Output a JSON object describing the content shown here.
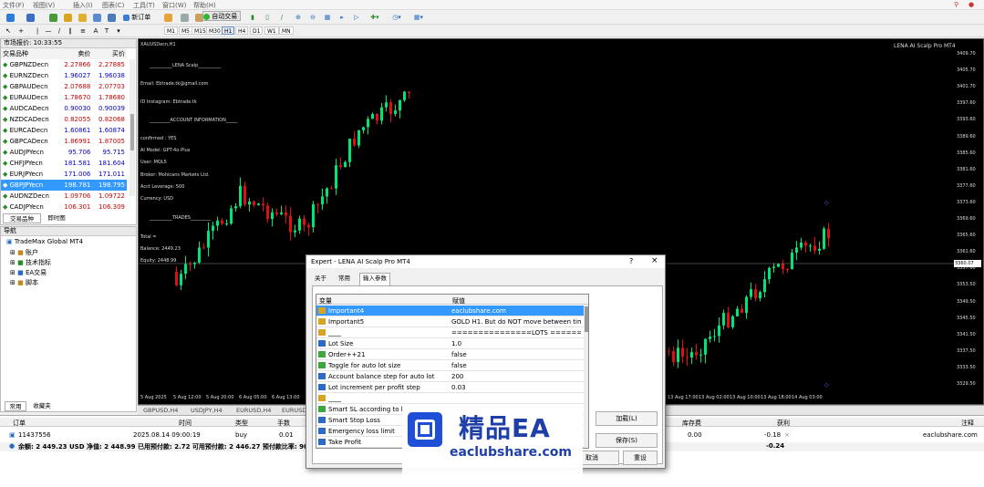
{
  "menu": [
    "文件(F)",
    "视图(V)",
    "插入(I)",
    "图表(C)",
    "工具(T)",
    "窗口(W)",
    "帮助(H)"
  ],
  "toolbar": {
    "new_order": "新订单",
    "auto_trade": "自动交易"
  },
  "timeframes": [
    "M1",
    "M5",
    "M15",
    "M30",
    "H1",
    "H4",
    "D1",
    "W1",
    "MN"
  ],
  "market_watch": {
    "title": "市场报价: 10:33:55",
    "col_symbol": "交易品种",
    "col_bid": "卖价",
    "col_ask": "买价",
    "rows": [
      {
        "symbol": "GBPNZDecn",
        "bid": "2.27866",
        "ask": "2.27885"
      },
      {
        "symbol": "EURNZDecn",
        "bid": "1.96027",
        "ask": "1.96038"
      },
      {
        "symbol": "GBPAUDecn",
        "bid": "2.07688",
        "ask": "2.07703"
      },
      {
        "symbol": "EURAUDecn",
        "bid": "1.78670",
        "ask": "1.78680"
      },
      {
        "symbol": "AUDCADecn",
        "bid": "0.90030",
        "ask": "0.90039"
      },
      {
        "symbol": "NZDCADecn",
        "bid": "0.82055",
        "ask": "0.82068"
      },
      {
        "symbol": "EURCADecn",
        "bid": "1.60861",
        "ask": "1.60874"
      },
      {
        "symbol": "GBPCADecn",
        "bid": "1.86991",
        "ask": "1.87005"
      },
      {
        "symbol": "AUDJPYecn",
        "bid": "95.706",
        "ask": "95.715"
      },
      {
        "symbol": "CHFJPYecn",
        "bid": "181.581",
        "ask": "181.604"
      },
      {
        "symbol": "EURJPYecn",
        "bid": "171.006",
        "ask": "171.011"
      },
      {
        "symbol": "GBPJPYecn",
        "bid": "198.781",
        "ask": "198.795"
      },
      {
        "symbol": "AUDNZDecn",
        "bid": "1.09706",
        "ask": "1.09722"
      },
      {
        "symbol": "CADJPYecn",
        "bid": "106.301",
        "ask": "106.309"
      }
    ],
    "tabs": [
      "交易品种",
      "即时图"
    ]
  },
  "navigator": {
    "title": "导航",
    "root": "TradeMax Global MT4",
    "items": [
      "账户",
      "技术指标",
      "EA交易",
      "脚本"
    ],
    "tabs": [
      "常用",
      "收藏夹"
    ]
  },
  "chart": {
    "symbol_label": "XAUUSDecn,H1",
    "ea_label": "LENA AI Scalp Pro MT4",
    "info_lines": [
      "__________LENA Scalp__________",
      "Email:       Ebtrade.tk@gmail.com",
      "ID Instagram:      Ebtrade.tk",
      "_________ACCOUNT INFORMATION_____",
      "confirmed :      YES",
      "AI Model:       GPT-4o-Plus",
      "User:               MQL5",
      "Broker:              Mohicans Markets Ltd.",
      "Acct Leverage:     500",
      "Currency:           USD",
      "__________TRADES_________",
      "Total =",
      "Balance:                2449.23",
      "Equity:                  2448.99"
    ],
    "price_axis": [
      "3409.70",
      "3405.70",
      "3401.70",
      "3397.60",
      "3393.60",
      "3389.60",
      "3385.60",
      "3381.60",
      "3377.60",
      "3373.60",
      "3369.60",
      "3365.60",
      "3361.60",
      "3357.60",
      "3353.50",
      "3349.50",
      "3345.50",
      "3341.50",
      "3337.50",
      "3333.50",
      "3329.50"
    ],
    "current_price": "3360.07",
    "time_axis_left": [
      "5 Aug 2025",
      "5 Aug 12:00",
      "5 Aug 20:00",
      "6 Aug 05:00",
      "6 Aug 13:00"
    ],
    "time_axis_right": [
      "13 Aug 17:00",
      "13 Aug 02:00",
      "13 Aug 10:00",
      "13 Aug 18:00",
      "14 Aug 03:00"
    ]
  },
  "chart_tabs": [
    "GBPUSD,H4",
    "USDJPY,H4",
    "EURUSD,H4",
    "EURUSD"
  ],
  "dialog": {
    "title": "Expert - LENA AI Scalp Pro MT4",
    "help": "?",
    "close": "×",
    "tabs": [
      "关于",
      "常用",
      "输入参数"
    ],
    "col_var": "变量",
    "col_val": "赋值",
    "rows": [
      {
        "name": "Important4",
        "value": "eaclubshare.com"
      },
      {
        "name": "Important5",
        "value": "GOLD H1. But do NOT move between tim..."
      },
      {
        "name": "____",
        "value": "===============LOTS ========="
      },
      {
        "name": "Lot Size",
        "value": "1.0"
      },
      {
        "name": "Order++21",
        "value": "false"
      },
      {
        "name": "Toggle for auto lot size",
        "value": "false"
      },
      {
        "name": "Account balance step for auto lot",
        "value": "200"
      },
      {
        "name": "Lot increment per profit step",
        "value": "0.03"
      },
      {
        "name": "____",
        "value": ""
      },
      {
        "name": "Smart SL according to b",
        "value": ""
      },
      {
        "name": "Smart Stop Loss",
        "value": ""
      },
      {
        "name": "Emergency loss limit",
        "value": ""
      },
      {
        "name": "Take Profit",
        "value": ""
      }
    ],
    "load": "加载(L)",
    "save": "保存(S)",
    "cancel": "取消",
    "reset": "重设"
  },
  "watermark": {
    "cn": "精品EA",
    "url": "eaclubshare.com"
  },
  "terminal": {
    "headers": [
      "订单",
      "时间",
      "类型",
      "手数",
      "库存费",
      "获利",
      "注释"
    ],
    "order_id": "11437556",
    "time": "2025.08.14 09:00:19",
    "type": "buy",
    "lots": "0.01",
    "swap": "0.00",
    "profit": "-0.18",
    "comment": "eaclubshare.com",
    "summary": "余额: 2 449.23 USD  净值: 2 448.99  已用预付款: 2.72  可用预付款: 2 446.27  预付款比率: 90145.10%",
    "summary_profit": "-0.24"
  },
  "colors": {
    "bull": "#00e676",
    "bear": "#e01010",
    "selected": "#3399ff",
    "bid_blue": "#0000cc",
    "ask_red": "#cc0000"
  }
}
